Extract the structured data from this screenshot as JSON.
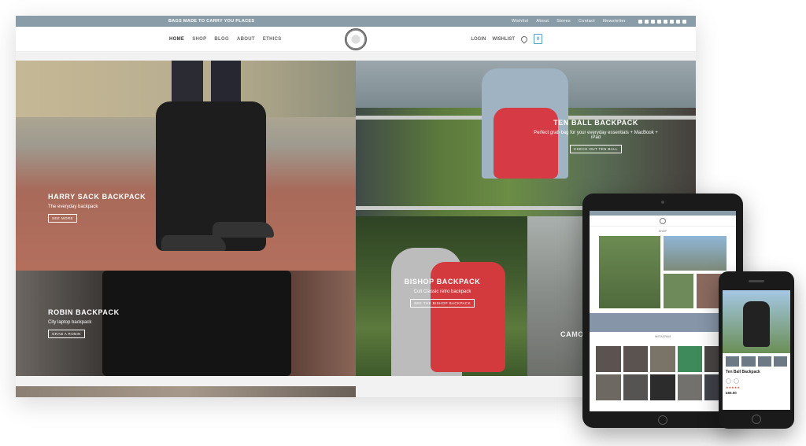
{
  "desktop": {
    "topbar": {
      "promo": "BAGS MADE TO CARRY YOU PLACES",
      "links": [
        "Wishlist",
        "About",
        "Stores",
        "Contact",
        "Newsletter"
      ]
    },
    "nav": {
      "left": [
        "HOME",
        "SHOP",
        "BLOG",
        "ABOUT",
        "ETHICS"
      ],
      "right": {
        "login": "LOGIN",
        "wishlist": "WISHLIST",
        "cart_count": "0"
      }
    },
    "tiles": {
      "harry": {
        "title": "HARRY SACK BACKPACK",
        "subtitle": "The everyday backpack",
        "cta": "SEE MORE"
      },
      "robin": {
        "title": "ROBIN BACKPACK",
        "subtitle": "City laptop backpack",
        "cta": "GRAB A ROBIN"
      },
      "ten": {
        "title": "TEN BALL BACKPACK",
        "subtitle": "Perfect grab bag for your everyday essentials + MacBook + iPad",
        "cta": "CHECK OUT TEN BALL"
      },
      "bishop": {
        "title": "BISHOP BACKPACK",
        "subtitle": "Cult Classic retro backpack",
        "cta": "SEE THE BISHOP BACKPACK"
      },
      "camo": {
        "title": "CAMO",
        "subtitle": ""
      }
    }
  },
  "tablet": {
    "label": "SHOP",
    "band_label": "INSTAGRAM"
  },
  "phone": {
    "title": "Ten Ball Backpack",
    "price": "£65.00",
    "stars": "★★★★★"
  }
}
